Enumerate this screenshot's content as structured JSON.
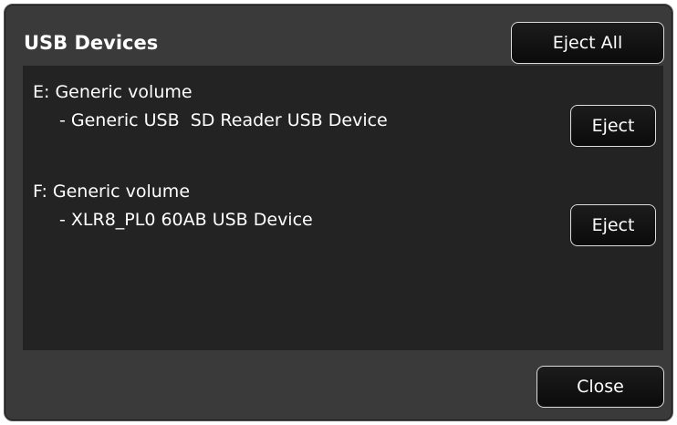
{
  "dialog": {
    "title": "USB Devices",
    "eject_all_label": "Eject All",
    "close_label": "Close"
  },
  "devices": [
    {
      "volume": "E: Generic volume",
      "name": "- Generic USB  SD Reader USB Device",
      "eject_label": "Eject"
    },
    {
      "volume": "F: Generic volume",
      "name": "- XLR8_PL0 60AB USB Device",
      "eject_label": "Eject"
    }
  ],
  "colors": {
    "dialog_bg": "#3a3a3a",
    "panel_bg": "#232323",
    "button_bg": "#111111",
    "button_border": "#dcdcdc",
    "text": "#ffffff"
  }
}
